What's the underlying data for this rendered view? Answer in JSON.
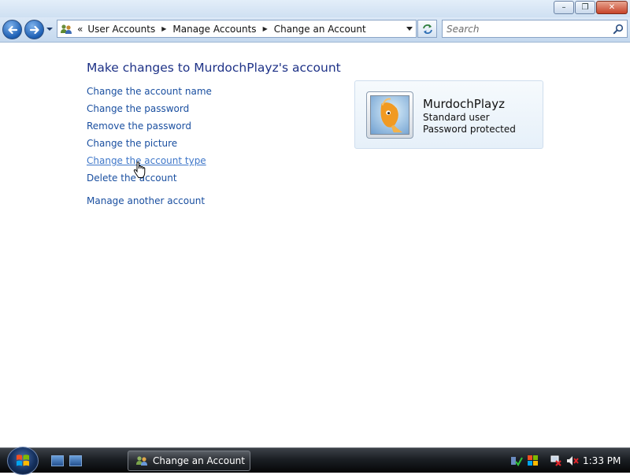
{
  "window": {
    "minimize_glyph": "–",
    "maximize_glyph": "❐",
    "close_glyph": "✕"
  },
  "navbar": {
    "address_chevron": "«",
    "breadcrumbs": [
      "User Accounts",
      "Manage Accounts",
      "Change an Account"
    ],
    "search_placeholder": "Search"
  },
  "content": {
    "title": "Make changes to MurdochPlayz's account",
    "tasks": [
      "Change the account name",
      "Change the password",
      "Remove the password",
      "Change the picture",
      "Change the account type",
      "Delete the account"
    ],
    "other_task": "Manage another account",
    "hovered_task_index": 4
  },
  "account": {
    "name": "MurdochPlayz",
    "type": "Standard user",
    "password_status": "Password protected"
  },
  "taskbar": {
    "active_window": "Change an Account",
    "clock": "1:33 PM"
  },
  "colors": {
    "title_color": "#1e3287",
    "link_color": "#1a4fa0",
    "link_hover_color": "#3f77c9"
  }
}
